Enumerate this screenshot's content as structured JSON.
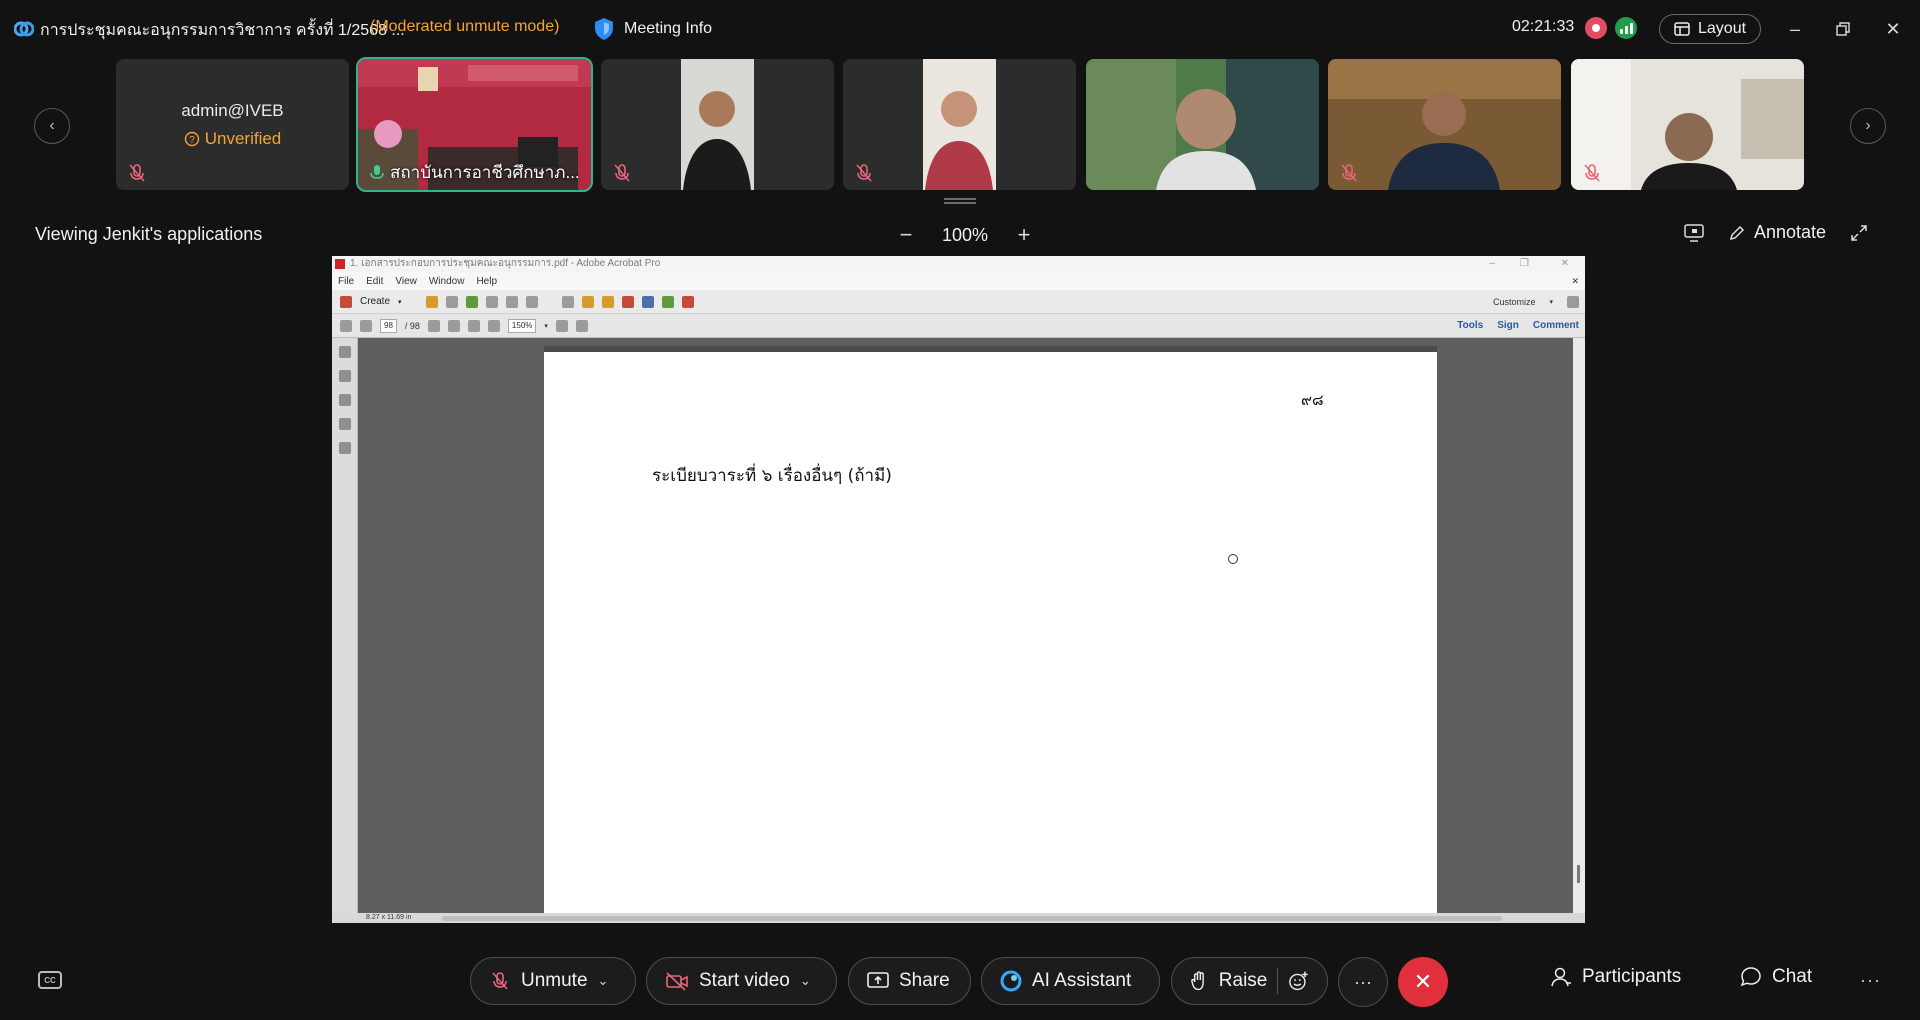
{
  "titlebar": {
    "meeting_title": "การประชุมคณะอนุกรรมการวิชาการ ครั้งที่ 1/2568 ...",
    "mode": "(Moderated unmute mode)",
    "meeting_info": "Meeting Info",
    "timer": "02:21:33",
    "layout": "Layout"
  },
  "participants": [
    {
      "name": "admin@IVEB",
      "status": "Unverified"
    },
    {
      "label": "สถาบันการอาชีวศึกษาภ..."
    },
    {},
    {},
    {},
    {},
    {}
  ],
  "share": {
    "viewing": "Viewing Jenkit's applications",
    "zoom": "100%",
    "annotate": "Annotate"
  },
  "acrobat": {
    "title": "1. เอกสารประกอบการประชุมคณะอนุกรรมการ.pdf - Adobe Acrobat Pro",
    "menu": [
      "File",
      "Edit",
      "View",
      "Window",
      "Help"
    ],
    "create": "Create",
    "customize": "Customize",
    "page_current": "98",
    "page_total": "/ 98",
    "zoom": "150%",
    "tools": "Tools",
    "sign": "Sign",
    "comment": "Comment",
    "page_size": "8.27 x 11.69 in"
  },
  "document": {
    "page_number": "๙๘",
    "heading": "ระเบียบวาระที่ ๖   เรื่องอื่นๆ (ถ้ามี)"
  },
  "controls": {
    "cc": "CC",
    "unmute": "Unmute",
    "start_video": "Start video",
    "share": "Share",
    "ai_assistant": "AI Assistant",
    "raise": "Raise",
    "more": "···",
    "participants": "Participants",
    "chat": "Chat",
    "overflow": "···"
  },
  "colors": {
    "accent_orange": "#f2a531",
    "active_tile": "#2fb493",
    "end_red": "#e0303e",
    "record": "#e44c64",
    "signal": "#1f9e4c"
  }
}
